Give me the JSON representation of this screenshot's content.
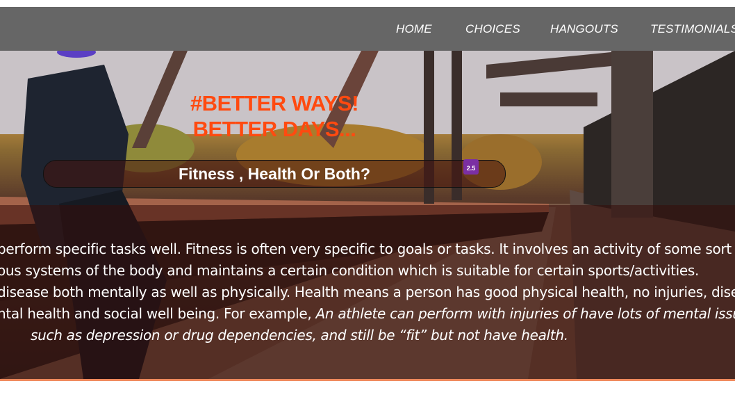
{
  "nav": {
    "items": [
      "HOME",
      "CHOICES",
      "HANGOUTS",
      "TESTIMONIALS"
    ]
  },
  "hero": {
    "title_line1": "#BETTER WAYS!",
    "title_line2": "BETTER DAYS...",
    "question": "Fitness , Health Or Both?",
    "badge": "2.5"
  },
  "body": {
    "line1": "perform specific tasks well. Fitness is often very specific to goals or tasks. It involves an activity of some sort that",
    "line2": "ous systems of the body and maintains a certain condition which is suitable for certain sports/activities.",
    "line3": "disease both mentally as well as physically. Health means a person has good physical health, no injuries, diseases",
    "line4_plain": "ntal health and social well being. For example, ",
    "line4_italic": "An athlete can perform with injuries of have lots of mental issues",
    "line5_italic": "such as depression or drug dependencies, and still be “fit” but not have health."
  },
  "colors": {
    "nav_bg": "#666666",
    "accent": "#ff4a10",
    "underline": "#f08a5d"
  }
}
